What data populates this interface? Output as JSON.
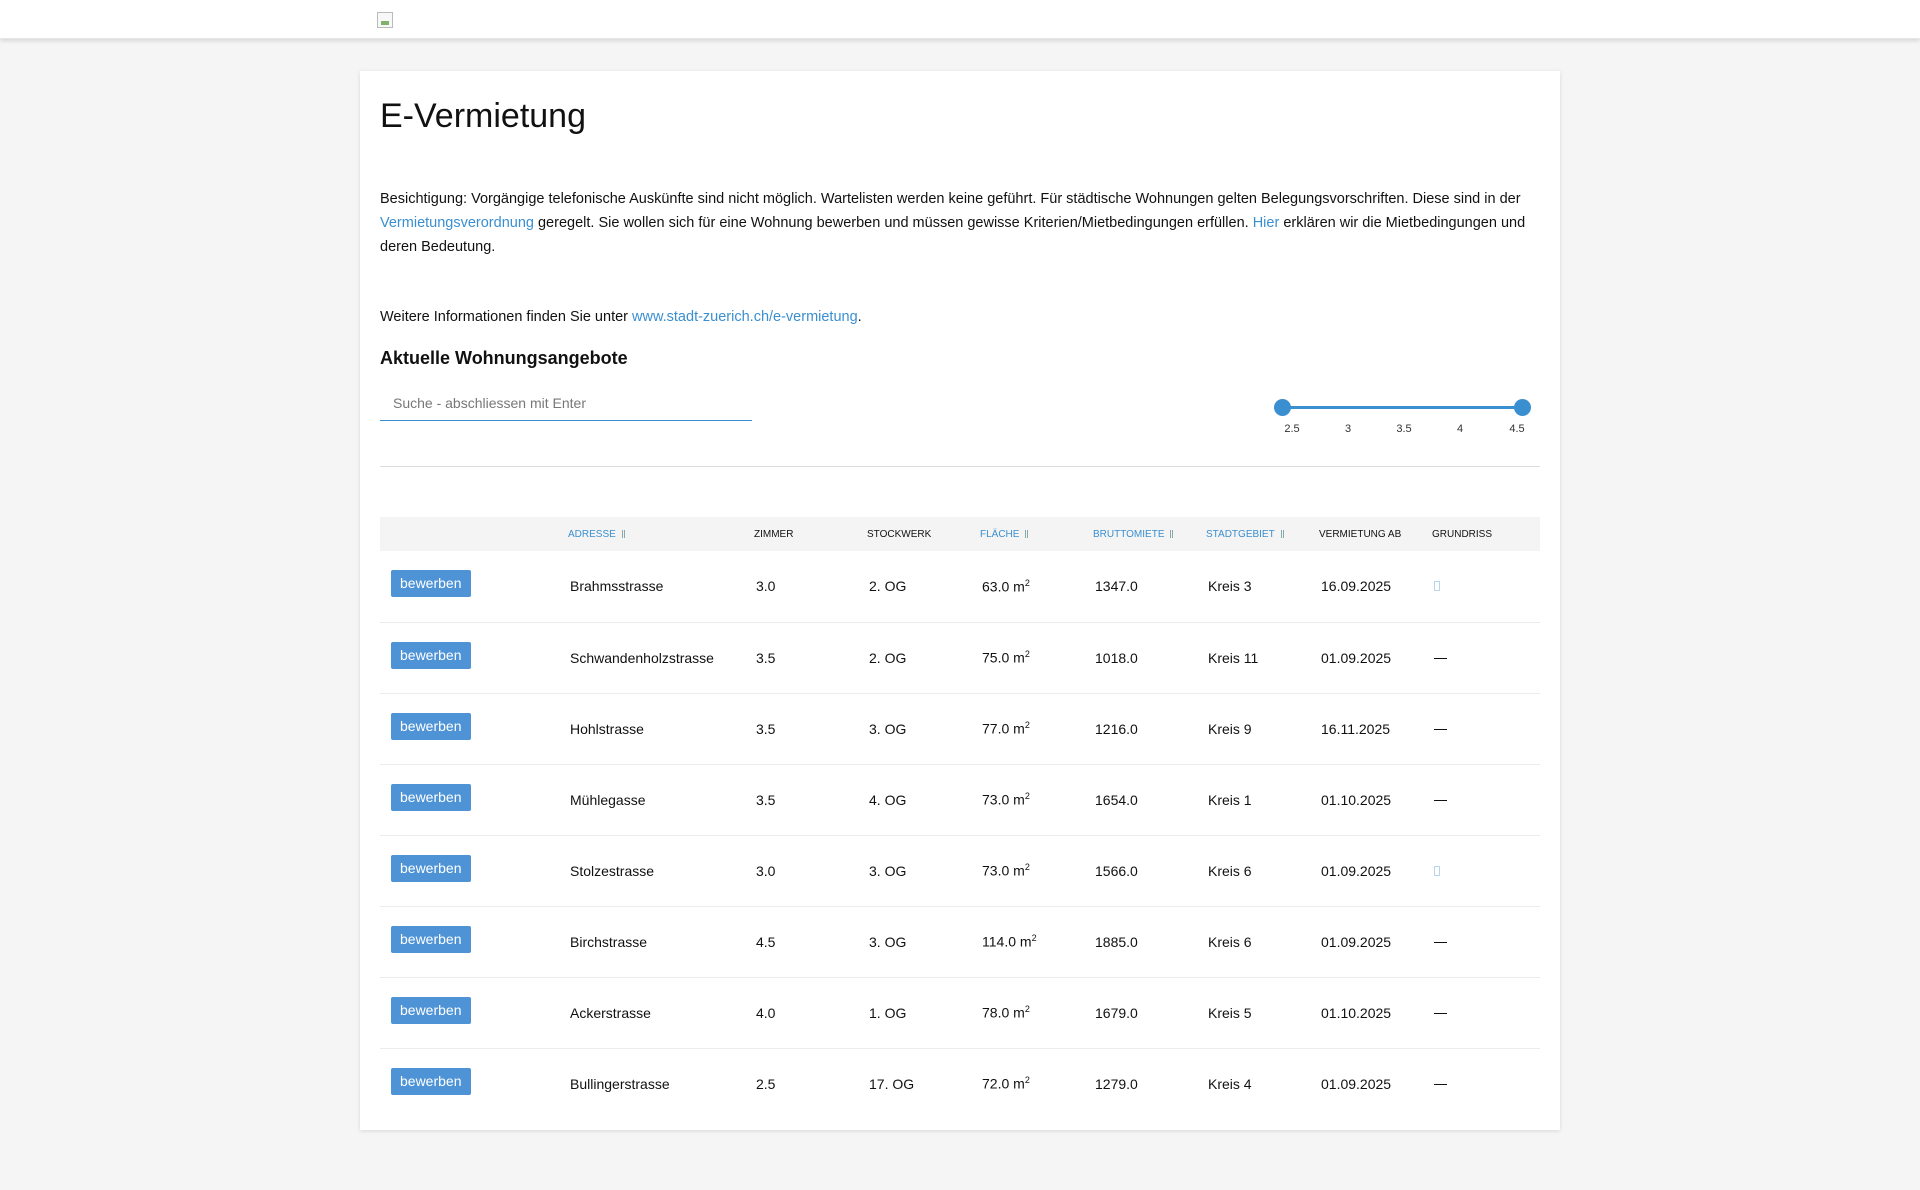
{
  "header": {
    "logo_alt": ""
  },
  "page": {
    "title": "E-Vermietung",
    "intro_1": "Besichtigung: Vorgängige telefonische Auskünfte sind nicht möglich. Wartelisten werden keine geführt. Für städtische Wohnungen gelten Belegungsvorschriften. Diese sind in der ",
    "intro_link_1": "Vermietungsverordnung",
    "intro_2": " geregelt. Sie wollen sich für eine Wohnung bewerben und müssen gewisse Kriterien/Mietbedingungen erfüllen. ",
    "intro_link_2": "Hier",
    "intro_3": " erklären wir die Mietbedingungen und deren Bedeutung.",
    "info_text": "Weitere Informationen finden Sie unter ",
    "info_link": "www.stadt-zuerich.ch/e-vermietung",
    "info_end": ".",
    "section_title": "Aktuelle Wohnungsangebote"
  },
  "search": {
    "placeholder": "Suche - abschliessen mit Enter",
    "value": ""
  },
  "slider": {
    "min_value": 2.5,
    "max_value": 4.5,
    "ticks": [
      "2.5",
      "3",
      "3.5",
      "4",
      "4.5"
    ]
  },
  "table": {
    "headers": [
      "",
      "Adresse",
      "Zimmer",
      "Stockwerk",
      "Fläche",
      "Bruttomiete",
      "Stadtgebiet",
      "Vermietung ab",
      "Grundriss"
    ],
    "apply_label": "bewerben",
    "area_unit": "m",
    "area_exp": "2",
    "rows": [
      {
        "adresse": "Brahmsstrasse",
        "zimmer": "3.0",
        "stockwerk": "2. OG",
        "flaeche": "63.0",
        "miete": "1347.0",
        "gebiet": "Kreis 3",
        "ab": "16.09.2025",
        "grundriss": true
      },
      {
        "adresse": "Schwandenholzstrasse",
        "zimmer": "3.5",
        "stockwerk": "2. OG",
        "flaeche": "75.0",
        "miete": "1018.0",
        "gebiet": "Kreis 11",
        "ab": "01.09.2025",
        "grundriss": false
      },
      {
        "adresse": "Hohlstrasse",
        "zimmer": "3.5",
        "stockwerk": "3. OG",
        "flaeche": "77.0",
        "miete": "1216.0",
        "gebiet": "Kreis 9",
        "ab": "16.11.2025",
        "grundriss": false
      },
      {
        "adresse": "Mühlegasse",
        "zimmer": "3.5",
        "stockwerk": "4. OG",
        "flaeche": "73.0",
        "miete": "1654.0",
        "gebiet": "Kreis 1",
        "ab": "01.10.2025",
        "grundriss": false
      },
      {
        "adresse": "Stolzestrasse",
        "zimmer": "3.0",
        "stockwerk": "3. OG",
        "flaeche": "73.0",
        "miete": "1566.0",
        "gebiet": "Kreis 6",
        "ab": "01.09.2025",
        "grundriss": true
      },
      {
        "adresse": "Birchstrasse",
        "zimmer": "4.5",
        "stockwerk": "3. OG",
        "flaeche": "114.0",
        "miete": "1885.0",
        "gebiet": "Kreis 6",
        "ab": "01.09.2025",
        "grundriss": false
      },
      {
        "adresse": "Ackerstrasse",
        "zimmer": "4.0",
        "stockwerk": "1. OG",
        "flaeche": "78.0",
        "miete": "1679.0",
        "gebiet": "Kreis 5",
        "ab": "01.10.2025",
        "grundriss": false
      },
      {
        "adresse": "Bullingerstrasse",
        "zimmer": "2.5",
        "stockwerk": "17. OG",
        "flaeche": "72.0",
        "miete": "1279.0",
        "gebiet": "Kreis 4",
        "ab": "01.09.2025",
        "grundriss": false
      }
    ]
  }
}
